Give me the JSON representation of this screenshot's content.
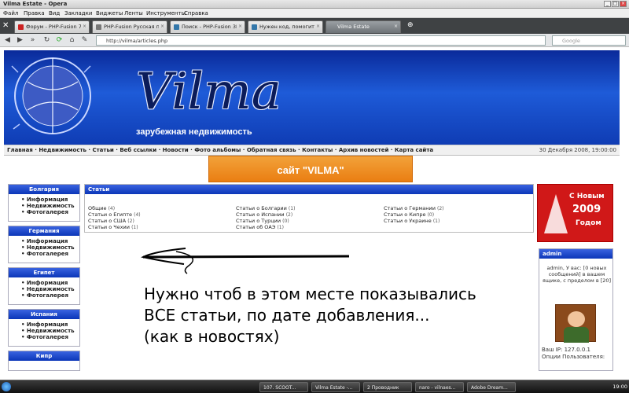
{
  "window": {
    "title": "Vilma Estate - Opera",
    "menu": [
      "Файл",
      "Правка",
      "Вид",
      "Закладки",
      "Виджеты",
      "Ленты",
      "Инструменты",
      "Справка"
    ]
  },
  "tabs": [
    {
      "label": "Форум - PHP-Fusion 7 р..."
    },
    {
      "label": "PHP-Fusion Русская по..."
    },
    {
      "label": "Поиск - PHP-Fusion 3F ..."
    },
    {
      "label": "Нужен код, помогите -..."
    },
    {
      "label": "Vilma Estate"
    }
  ],
  "address": {
    "url": "http://vilma/articles.php",
    "search_placeholder": "Google"
  },
  "site": {
    "logo": "Vilma",
    "subtitle": "зарубежная недвижимость",
    "nav": "Главная · Недвижимость · Статьи · Веб ссылки · Новости · Фото альбомы · Обратная связь · Контакты · Архив новостей · Карта сайта",
    "date": "30 Декабря 2008, 19:00:00",
    "ad": "сайт \"VILMA\""
  },
  "left_boxes": [
    {
      "title": "Болгария",
      "items": [
        "Информация",
        "Недвижимость",
        "Фотогалерея"
      ]
    },
    {
      "title": "Германия",
      "items": [
        "Информация",
        "Недвижимость",
        "Фотогалерея"
      ]
    },
    {
      "title": "Египет",
      "items": [
        "Информация",
        "Недвижимость",
        "Фотогалерея"
      ]
    },
    {
      "title": "Испания",
      "items": [
        "Информация",
        "Недвижимость",
        "Фотогалерея"
      ]
    },
    {
      "title": "Кипр",
      "items": []
    }
  ],
  "articles": {
    "title": "Статьи",
    "categories": [
      {
        "name": "Общие",
        "count": "(4)"
      },
      {
        "name": "Статьи о Болгарии",
        "count": "(1)"
      },
      {
        "name": "Статьи о Германии",
        "count": "(2)"
      },
      {
        "name": "Статьи о Египте",
        "count": "(4)"
      },
      {
        "name": "Статьи о Испании",
        "count": "(2)"
      },
      {
        "name": "Статьи о Кипре",
        "count": "(0)"
      },
      {
        "name": "Статьи о США",
        "count": "(2)"
      },
      {
        "name": "Статьи о Турции",
        "count": "(0)"
      },
      {
        "name": "Статьи о Украине",
        "count": "(1)"
      },
      {
        "name": "Статьи о Чехии",
        "count": "(1)"
      },
      {
        "name": "Статьи об ОАЭ",
        "count": "(1)"
      }
    ]
  },
  "new_year": {
    "line1": "С Новым",
    "line2": "2009",
    "line3": "Годом"
  },
  "user_panel": {
    "title": "admin",
    "greeting": "admin, У вас: [0 новых сообщений] в вашем ящике, с пределом в [20]",
    "ip": "Ваш IP: 127.0.0.1",
    "options": "Опции Пользователя:"
  },
  "annotation": {
    "line1": "Нужно чтоб в этом месте показывались",
    "line2": "ВСЕ статьи, по дате добавления...",
    "line3": "(как в новостях)"
  },
  "taskbar": {
    "items": [
      "107. SCOOT...",
      "Vilma Estate -...",
      "2 Проводник",
      "naro - vilnaes...",
      "Adobe Dream..."
    ],
    "clock": "19:00"
  }
}
